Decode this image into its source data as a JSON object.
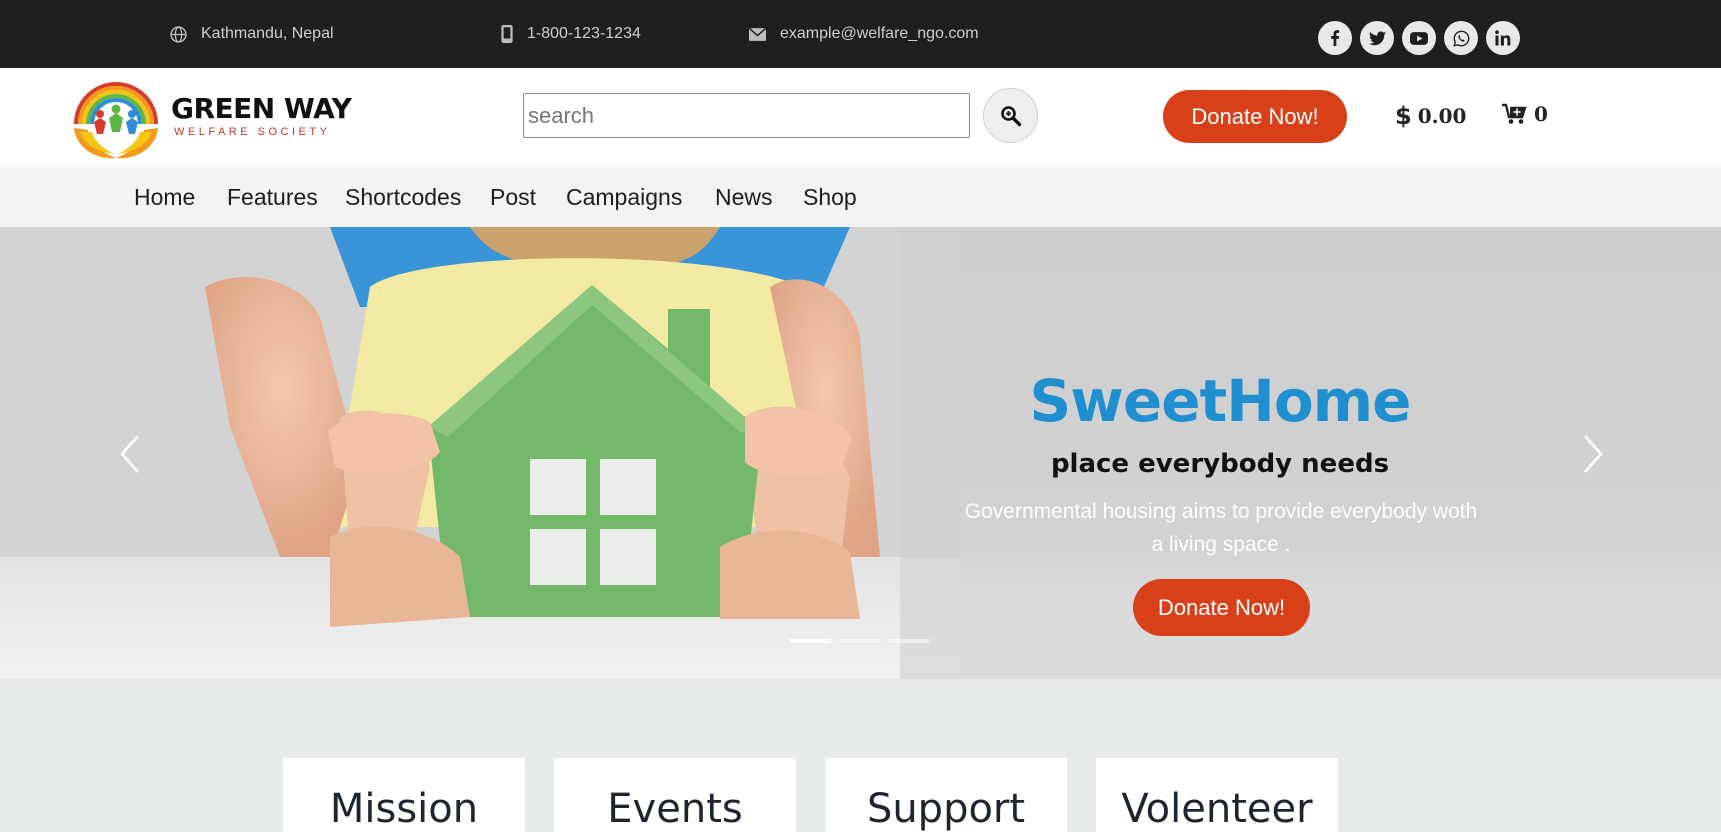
{
  "topbar": {
    "location": "Kathmandu, Nepal",
    "phone": "1-800-123-1234",
    "email": "example@welfare_ngo.com",
    "socials": [
      "facebook-icon",
      "twitter-icon",
      "youtube-icon",
      "whatsapp-icon",
      "linkedin-icon"
    ]
  },
  "header": {
    "brand_name": "GREEN WAY",
    "brand_tagline": "WELFARE SOCIETY",
    "search_placeholder": "search",
    "donate_label": "Donate Now!",
    "wallet_amount": "0.00",
    "cart_count": "0"
  },
  "nav": {
    "items": [
      "Home",
      "Features",
      "Shortcodes",
      "Post",
      "Campaigns",
      "News",
      "Shop"
    ]
  },
  "hero": {
    "title": "SweetHome",
    "subtitle": "place everybody needs",
    "description": "Governmental housing aims to provide everybody woth a living space .",
    "donate_label": "Donate Now!",
    "slides": 3,
    "active_slide": 1
  },
  "features": {
    "cards": [
      "Mission",
      "Events",
      "Support",
      "Volenteer"
    ]
  },
  "colors": {
    "accent": "#d8401a",
    "hero_title": "#1f8fcf",
    "topbar_bg": "#1e1e1e"
  }
}
